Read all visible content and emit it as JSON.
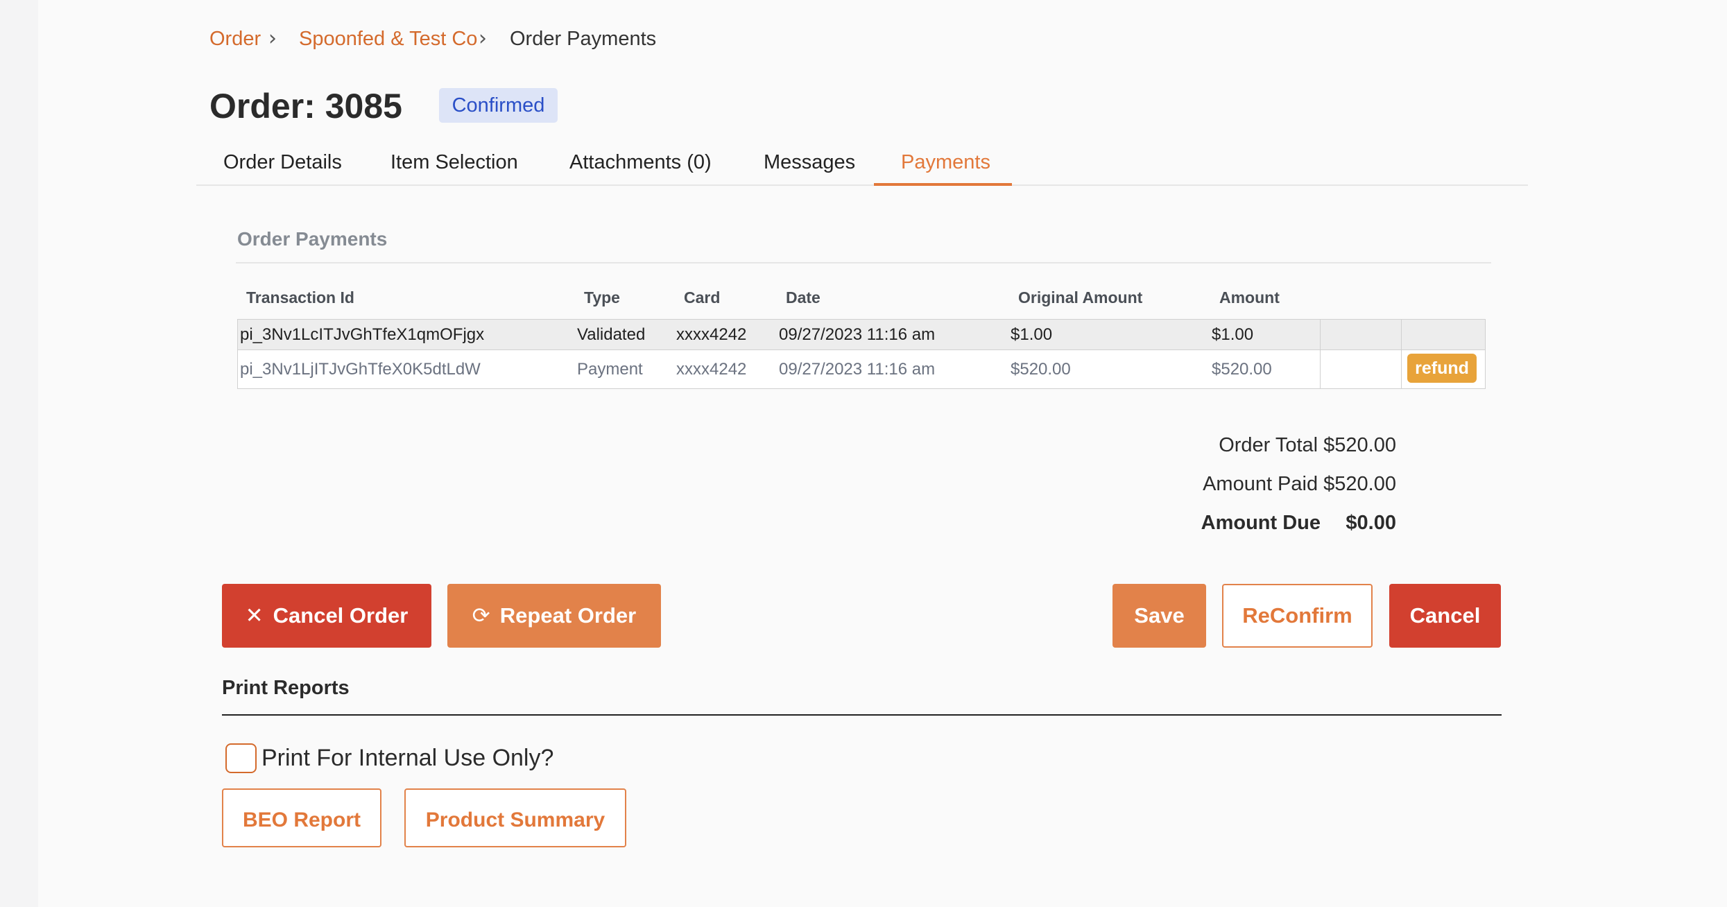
{
  "breadcrumb": {
    "items": [
      "Order",
      "Spoonfed & Test Co",
      "Order Payments"
    ]
  },
  "order": {
    "title": "Order: 3085",
    "status": "Confirmed"
  },
  "tabs": [
    {
      "label": "Order Details"
    },
    {
      "label": "Item Selection"
    },
    {
      "label": "Attachments (0)"
    },
    {
      "label": "Messages"
    },
    {
      "label": "Payments",
      "active": true
    }
  ],
  "payments": {
    "heading": "Order Payments",
    "columns": [
      "Transaction Id",
      "Type",
      "Card",
      "Date",
      "Original Amount",
      "Amount"
    ],
    "rows": [
      {
        "id": "pi_3Nv1LcITJvGhTfeX1qmOFjgx",
        "type": "Validated",
        "card": "xxxx4242",
        "date": "09/27/2023 11:16 am",
        "original": "$1.00",
        "amount": "$1.00",
        "action": ""
      },
      {
        "id": "pi_3Nv1LjITJvGhTfeX0K5dtLdW",
        "type": "Payment",
        "card": "xxxx4242",
        "date": "09/27/2023 11:16 am",
        "original": "$520.00",
        "amount": "$520.00",
        "action": "refund"
      }
    ]
  },
  "totals": {
    "order_total_label": "Order Total",
    "order_total": "$520.00",
    "amount_paid_label": "Amount Paid",
    "amount_paid": "$520.00",
    "amount_due_label": "Amount Due",
    "amount_due": "$0.00"
  },
  "actions": {
    "cancel_order": "Cancel Order",
    "repeat_order": "Repeat Order",
    "save": "Save",
    "reconfirm": "ReConfirm",
    "cancel": "Cancel"
  },
  "print_reports": {
    "heading": "Print Reports",
    "internal_label": "Print For Internal Use Only?",
    "internal_checked": false,
    "beo_report": "BEO Report",
    "product_summary": "Product Summary"
  },
  "colors": {
    "accent": "#e2783a",
    "danger": "#d2402f",
    "badge_bg": "#dde4f7",
    "badge_text": "#2a4fc7",
    "refund": "#e8a33a"
  },
  "icons": {
    "breadcrumb_separator": "chevron-right-icon",
    "cancel_order": "close-icon",
    "repeat_order": "refresh-icon"
  }
}
